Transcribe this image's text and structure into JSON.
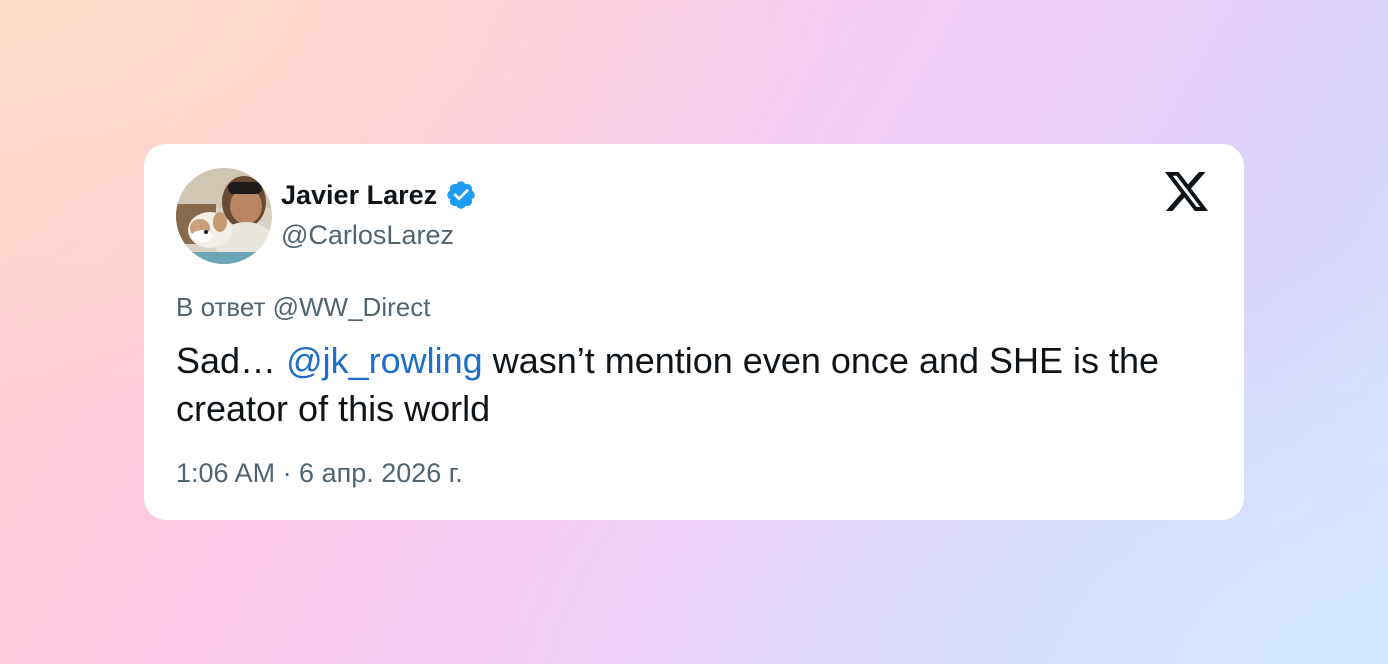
{
  "author": {
    "name": "Javier Larez",
    "handle": "@CarlosLarez",
    "verified_icon": "verified-badge-icon",
    "verified_color": "#1d9bf0"
  },
  "platform_icon": "x-logo-icon",
  "reply": {
    "text": "В ответ @WW_Direct"
  },
  "tweet": {
    "prefix": "Sad… ",
    "mention": "@jk_rowling",
    "suffix": " wasn’t mention even once and SHE is the creator of this world"
  },
  "timestamp": "1:06 AM · 6 апр. 2026 г.",
  "colors": {
    "text_primary": "#0f1419",
    "text_secondary": "#536471",
    "mention": "#1d6fc9",
    "card_background": "#ffffff"
  }
}
